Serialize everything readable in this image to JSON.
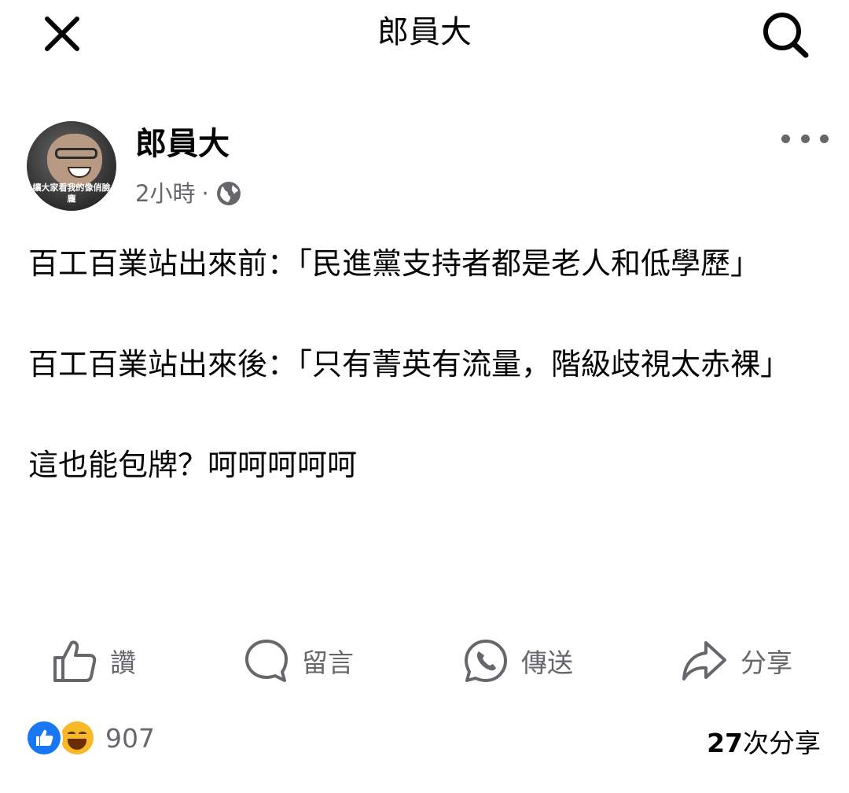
{
  "header": {
    "title": "郎員大",
    "close_icon": "close-icon",
    "search_icon": "search-icon"
  },
  "post": {
    "author": "郎員大",
    "avatar_caption": "讓大家看我的像俏臉龐",
    "time": "2小時",
    "separator": "·",
    "privacy_icon": "globe-icon",
    "more_icon": "more-icon",
    "body": [
      "百工百業站出來前：「民進黨支持者都是老人和低學歷」",
      "百工百業站出來後：「只有菁英有流量，階級歧視太赤裸」",
      "這也能包牌？呵呵呵呵呵"
    ]
  },
  "actions": {
    "like": "讚",
    "comment": "留言",
    "send": "傳送",
    "share": "分享"
  },
  "stats": {
    "reaction_count": "907",
    "share_count_number": "27",
    "share_count_suffix": "次分享",
    "reaction_icons": [
      "like-reaction-icon",
      "haha-reaction-icon"
    ],
    "like_color": "#1877f2",
    "haha_color": "#f7b928"
  }
}
